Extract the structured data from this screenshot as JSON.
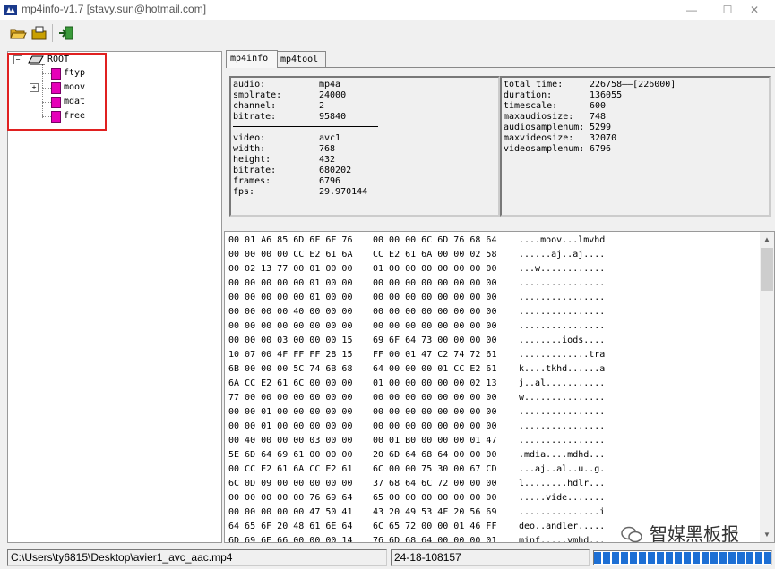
{
  "window": {
    "title": "mp4info-v1.7 [stavy.sun@hotmail.com]"
  },
  "icons": [
    "app-icon",
    "open-folder-icon",
    "save-folder-icon",
    "exit-icon",
    "minimize-icon",
    "maximize-icon",
    "close-icon"
  ],
  "tree": {
    "root": "ROOT",
    "children": [
      {
        "label": "ftyp",
        "expandable": false
      },
      {
        "label": "moov",
        "expandable": true
      },
      {
        "label": "mdat",
        "expandable": false
      },
      {
        "label": "free",
        "expandable": false
      }
    ]
  },
  "tabs": [
    {
      "label": "mp4info",
      "active": true
    },
    {
      "label": "mp4tool",
      "active": false
    }
  ],
  "audio": [
    {
      "key": "audio:",
      "value": "mp4a"
    },
    {
      "key": "smplrate:",
      "value": "24000"
    },
    {
      "key": "channel:",
      "value": "2"
    },
    {
      "key": "bitrate:",
      "value": "95840"
    }
  ],
  "video": [
    {
      "key": "video:",
      "value": "avc1"
    },
    {
      "key": "width:",
      "value": "768"
    },
    {
      "key": "height:",
      "value": "432"
    },
    {
      "key": "bitrate:",
      "value": "680202"
    },
    {
      "key": "frames:",
      "value": "6796"
    },
    {
      "key": "fps:",
      "value": "29.970144"
    }
  ],
  "summary": [
    {
      "key": "total_time:",
      "value": "226758——[226000]"
    },
    {
      "key": "duration:",
      "value": "136055"
    },
    {
      "key": "timescale:",
      "value": "600"
    },
    {
      "key": "maxaudiosize:",
      "value": "748"
    },
    {
      "key": "audiosamplenum:",
      "value": "5299"
    },
    {
      "key": "maxvideosize:",
      "value": "32070"
    },
    {
      "key": "videosamplenum:",
      "value": "6796"
    }
  ],
  "hex_rows": [
    {
      "h1": "00 01 A6 85 6D 6F 6F 76",
      "h2": "00 00 00 6C 6D 76 68 64",
      "ascii": "....moov...lmvhd"
    },
    {
      "h1": "00 00 00 00 CC E2 61 6A",
      "h2": "CC E2 61 6A 00 00 02 58",
      "ascii": "......aj..aj...."
    },
    {
      "h1": "00 02 13 77 00 01 00 00",
      "h2": "01 00 00 00 00 00 00 00",
      "ascii": "...w............"
    },
    {
      "h1": "00 00 00 00 00 01 00 00",
      "h2": "00 00 00 00 00 00 00 00",
      "ascii": "................"
    },
    {
      "h1": "00 00 00 00 00 01 00 00",
      "h2": "00 00 00 00 00 00 00 00",
      "ascii": "................"
    },
    {
      "h1": "00 00 00 00 40 00 00 00",
      "h2": "00 00 00 00 00 00 00 00",
      "ascii": "................"
    },
    {
      "h1": "00 00 00 00 00 00 00 00",
      "h2": "00 00 00 00 00 00 00 00",
      "ascii": "................"
    },
    {
      "h1": "00 00 00 03 00 00 00 15",
      "h2": "69 6F 64 73 00 00 00 00",
      "ascii": "........iods...."
    },
    {
      "h1": "10 07 00 4F FF FF 28 15",
      "h2": "FF 00 01 47 C2 74 72 61",
      "ascii": ".............tra"
    },
    {
      "h1": "6B 00 00 00 5C 74 6B 68",
      "h2": "64 00 00 00 01 CC E2 61",
      "ascii": "k....tkhd......a"
    },
    {
      "h1": "6A CC E2 61 6C 00 00 00",
      "h2": "01 00 00 00 00 00 02 13",
      "ascii": "j..al..........."
    },
    {
      "h1": "77 00 00 00 00 00 00 00",
      "h2": "00 00 00 00 00 00 00 00",
      "ascii": "w..............."
    },
    {
      "h1": "00 00 01 00 00 00 00 00",
      "h2": "00 00 00 00 00 00 00 00",
      "ascii": "................"
    },
    {
      "h1": "00 00 01 00 00 00 00 00",
      "h2": "00 00 00 00 00 00 00 00",
      "ascii": "................"
    },
    {
      "h1": "00 40 00 00 00 03 00 00",
      "h2": "00 01 B0 00 00 00 01 47",
      "ascii": "................"
    },
    {
      "h1": "5E 6D 64 69 61 00 00 00",
      "h2": "20 6D 64 68 64 00 00 00",
      "ascii": ".mdia....mdhd..."
    },
    {
      "h1": "00 CC E2 61 6A CC E2 61",
      "h2": "6C 00 00 75 30 00 67 CD",
      "ascii": "...aj..al..u..g."
    },
    {
      "h1": "6C 0D 09 00 00 00 00 00",
      "h2": "37 68 64 6C 72 00 00 00",
      "ascii": "l........hdlr..."
    },
    {
      "h1": "00 00 00 00 00 76 69 64",
      "h2": "65 00 00 00 00 00 00 00",
      "ascii": ".....vide......."
    },
    {
      "h1": "00 00 00 00 00 47 50 41",
      "h2": "43 20 49 53 4F 20 56 69",
      "ascii": "...............i"
    },
    {
      "h1": "64 65 6F 20 48 61 6E 64",
      "h2": "6C 65 72 00 00 01 46 FF",
      "ascii": "deo..andler....."
    },
    {
      "h1": "6D 69 6E 66 00 00 00 14",
      "h2": "76 6D 68 64 00 00 00 01",
      "ascii": "minf.....vmhd..."
    }
  ],
  "status": {
    "path": "C:\\Users\\ty6815\\Desktop\\avier1_avc_aac.mp4",
    "info": "24-18-108157",
    "progress": 1.0
  },
  "watermark": "智媒黑板报"
}
